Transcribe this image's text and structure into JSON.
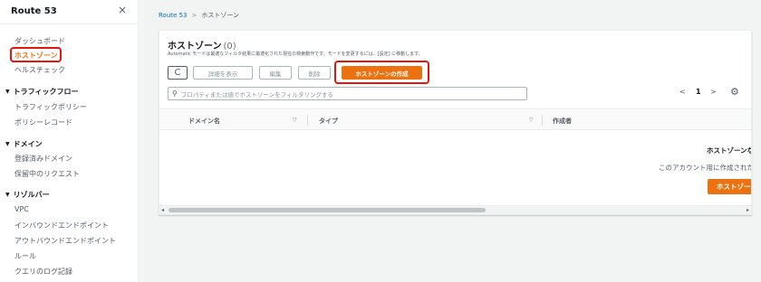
{
  "sidebar": {
    "title": "Route 53",
    "close_icon": "×",
    "top_items": [
      {
        "label": "ダッシュボード"
      },
      {
        "label": "ホストゾーン",
        "active": true
      },
      {
        "label": "ヘルスチェック"
      }
    ],
    "sections": [
      {
        "title": "トラフィックフロー",
        "items": [
          {
            "label": "トラフィックポリシー"
          },
          {
            "label": "ポリシーレコード"
          }
        ]
      },
      {
        "title": "ドメイン",
        "items": [
          {
            "label": "登録済みドメイン"
          },
          {
            "label": "保留中のリクエスト"
          }
        ]
      },
      {
        "title": "リゾルバー",
        "items": [
          {
            "label": "VPC"
          },
          {
            "label": "インバウンドエンドポイント"
          },
          {
            "label": "アウトバウンドエンドポイント"
          },
          {
            "label": "ルール"
          },
          {
            "label": "クエリのログ記録"
          }
        ]
      }
    ]
  },
  "breadcrumb": {
    "root": "Route 53",
    "separator": ">",
    "current": "ホストゾーン"
  },
  "panel": {
    "title": "ホストゾーン",
    "count": "(0)",
    "description": "Automatic モードは最適なフィルタ結果に最適化された現在の検索動作です。モードを変更するには、[設定] に移動します。",
    "buttons": {
      "refresh": "C",
      "details": "詳細を表示",
      "edit": "編集",
      "delete": "削除",
      "create": "ホストゾーンの作成"
    },
    "search_placeholder": "プロパティまたは値でホストゾーンをフィルタリングする",
    "pager": {
      "prev": "<",
      "page": "1",
      "next": ">"
    },
    "columns": [
      "ドメイン名",
      "タイプ",
      "作成者"
    ],
    "empty": {
      "title": "ホストゾーンな",
      "description": "このアカウント用に作成された",
      "button": "ホストゾー"
    }
  },
  "colors": {
    "accent": "#ec7211",
    "link": "#0073bb",
    "highlight": "#e3150f"
  }
}
